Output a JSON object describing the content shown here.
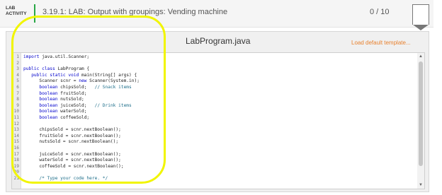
{
  "header": {
    "tag_line1": "LAB",
    "tag_line2": "ACTIVITY",
    "title": "3.19.1: LAB: Output with groupings: Vending machine",
    "score": "0 / 10",
    "accent_color": "#28a745"
  },
  "panel": {
    "filename": "LabProgram.java",
    "load_template_label": "Load default template..."
  },
  "editor": {
    "lines": [
      {
        "n": "1",
        "t": "import java.util.Scanner;"
      },
      {
        "n": "2",
        "t": ""
      },
      {
        "n": "3",
        "t": "public class LabProgram {"
      },
      {
        "n": "4",
        "t": "   public static void main(String[] args) {"
      },
      {
        "n": "5",
        "t": "      Scanner scnr = new Scanner(System.in);"
      },
      {
        "n": "6",
        "t": "      boolean chipsSold;   // Snack items"
      },
      {
        "n": "7",
        "t": "      boolean fruitSold;"
      },
      {
        "n": "8",
        "t": "      boolean nutsSold;"
      },
      {
        "n": "9",
        "t": "      boolean juiceSold;   // Drink items"
      },
      {
        "n": "10",
        "t": "      boolean waterSold;"
      },
      {
        "n": "11",
        "t": "      boolean coffeeSold;"
      },
      {
        "n": "12",
        "t": ""
      },
      {
        "n": "13",
        "t": "      chipsSold = scnr.nextBoolean();"
      },
      {
        "n": "14",
        "t": "      fruitSold = scnr.nextBoolean();"
      },
      {
        "n": "15",
        "t": "      nutsSold = scnr.nextBoolean();"
      },
      {
        "n": "16",
        "t": ""
      },
      {
        "n": "17",
        "t": "      juiceSold = scnr.nextBoolean();"
      },
      {
        "n": "18",
        "t": "      waterSold = scnr.nextBoolean();"
      },
      {
        "n": "19",
        "t": "      coffeeSold = scnr.nextBoolean();"
      },
      {
        "n": "20",
        "t": ""
      },
      {
        "n": "21",
        "t": "      /* Type your code here. */"
      }
    ],
    "keyword_color": "#0000cc",
    "comment_color": "#1f6f8b"
  },
  "annotation": {
    "highlight_color": "#f1f500"
  }
}
